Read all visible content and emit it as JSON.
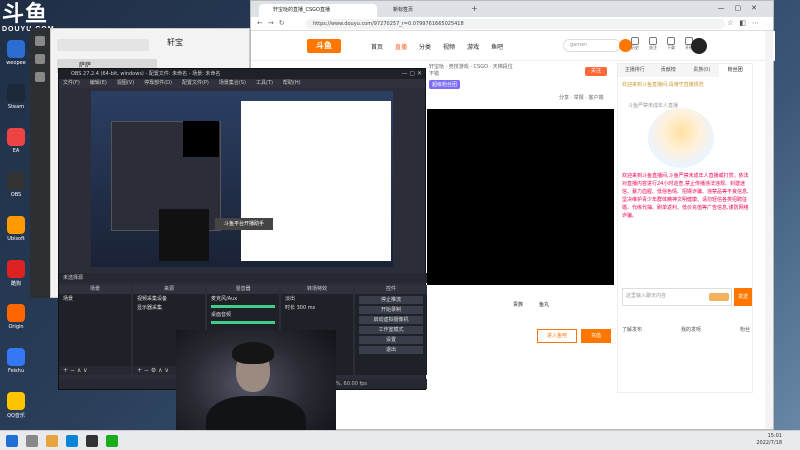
{
  "brand": {
    "big": "斗鱼",
    "small": "DOUYU.COM"
  },
  "desktop": {
    "icons": [
      {
        "label": "weopee",
        "color": "#2b6cd1"
      },
      {
        "label": "Steam",
        "color": "#1b2838"
      },
      {
        "label": "EA",
        "color": "#e44"
      },
      {
        "label": "OBS",
        "color": "#333"
      },
      {
        "label": "Ubisoft",
        "color": "#f90"
      },
      {
        "label": "酷狗",
        "color": "#d22"
      },
      {
        "label": "Origin",
        "color": "#f60"
      },
      {
        "label": "Feishu",
        "color": "#3478f6"
      },
      {
        "label": "QQ音乐",
        "color": "#ffc400"
      }
    ]
  },
  "qq": {
    "title": "轩宝",
    "contact": "萨萨"
  },
  "obs": {
    "title": "OBS 27.2.4 (64-bit, windows) - 配置文件: 未命名 - 场景: 未命名",
    "menu": [
      "文件(F)",
      "编辑(E)",
      "视图(V)",
      "停靠部件(D)",
      "配置文件(P)",
      "场景集合(S)",
      "工具(T)",
      "帮助(H)"
    ],
    "scene_bar": "未选择源",
    "docks": {
      "scenes": {
        "header": "场景",
        "items": [
          "场景"
        ]
      },
      "sources": {
        "header": "来源",
        "items": [
          "视频采集设备",
          "显示器采集"
        ]
      },
      "mixer": {
        "header": "混音器",
        "items": [
          "麦克风/Aux",
          "桌面音频"
        ]
      },
      "transitions": {
        "header": "转场特效",
        "items": [
          "淡出",
          "时长 300 ms"
        ]
      },
      "controls": {
        "header": "控件",
        "buttons": [
          "停止推流",
          "开始录制",
          "启动虚拟摄像机",
          "工作室模式",
          "设置",
          "退出"
        ]
      }
    },
    "status": "CPU: 5.4%, 60.00 fps",
    "popup": "斗鱼平台开播助手"
  },
  "browser": {
    "tabs": [
      "轩宝哒的直播_CSGO直播",
      "新标签页"
    ],
    "url": "https://www.douyu.com/97270257_r=0.0799761665025418",
    "nav": [
      "首页",
      "直播",
      "分类",
      "视频",
      "游戏",
      "鱼吧"
    ],
    "search_placeholder": "gamen",
    "user_icons": [
      "历史",
      "关注",
      "下载",
      "开播"
    ],
    "room": {
      "line1": "轩宝哒 · 竞技游戏 · CSGO · 天梯段位",
      "line2": "不错",
      "tag": "超级粉丝团",
      "follow": "关注",
      "share": "分享 · 举报 · 客户端"
    },
    "gift_labels": [
      "贵族",
      "鱼丸"
    ],
    "chips": [
      {
        "label": "分享",
        "color": "#ff5a5a"
      },
      {
        "label": "付费",
        "color": "#3fa9f5"
      }
    ],
    "recharge": "进入鱼吧",
    "recharge2": "充值",
    "side": {
      "tabs": [
        "主播排行",
        "贡献榜",
        "贵族(0)",
        "粉丝团"
      ],
      "notice": "欢迎来到斗鱼直播间,请遵守直播规范",
      "mascot_caption": "斗鱼严禁未成年人直播",
      "chat": "欢迎来到斗鱼直播间,斗鱼严禁未成年人直播或打赏。依法对直播内容进行24小时巡查,禁止传播违法违规、封建迷信、暴力血腥、低俗色情、招嫖诈骗、违禁品等不良信息,坚决维护青少年群体精神文明健康。请勿轻信各类招聘征婚、代练代抽、刷单返利、低价充值等广告信息,谨防网络诈骗。",
      "input_placeholder": "这里输入聊天内容",
      "send": "发送",
      "rank_left": "了解发布",
      "rank_mid": "我的发呀",
      "rank_right": "粉丝"
    }
  },
  "taskbar": {
    "time": "15:01",
    "date": "2022/7/18"
  }
}
